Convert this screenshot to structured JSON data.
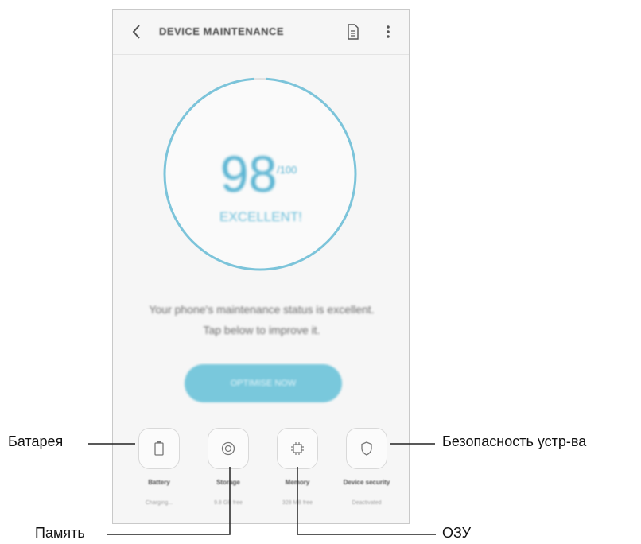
{
  "app": {
    "title": "DEVICE MAINTENANCE"
  },
  "appbar_icons": [
    "chevron-left-icon",
    "report-icon",
    "more-vertical-icon"
  ],
  "score": {
    "value": "98",
    "max": "/100",
    "status": "EXCELLENT!",
    "fraction": 0.98
  },
  "message": "Your phone's maintenance status is excellent. Tap below to improve it.",
  "optimise_button": "OPTIMISE NOW",
  "tiles": [
    {
      "icon": "battery-icon",
      "label": "Battery",
      "sub": "Charging..."
    },
    {
      "icon": "storage-icon",
      "label": "Storage",
      "sub": "9.8 GB free"
    },
    {
      "icon": "memory-chip-icon",
      "label": "Memory",
      "sub": "328 MB free"
    },
    {
      "icon": "shield-icon",
      "label": "Device security",
      "sub": "Deactivated"
    }
  ],
  "callouts": {
    "battery": "Батарея",
    "storage": "Память",
    "memory": "ОЗУ",
    "security": "Безопасность устр-ва"
  },
  "colors": {
    "accent": "#6fc0db",
    "button": "#79c8dc",
    "frame": "#c9c9c9",
    "background": "#f6f6f6"
  }
}
